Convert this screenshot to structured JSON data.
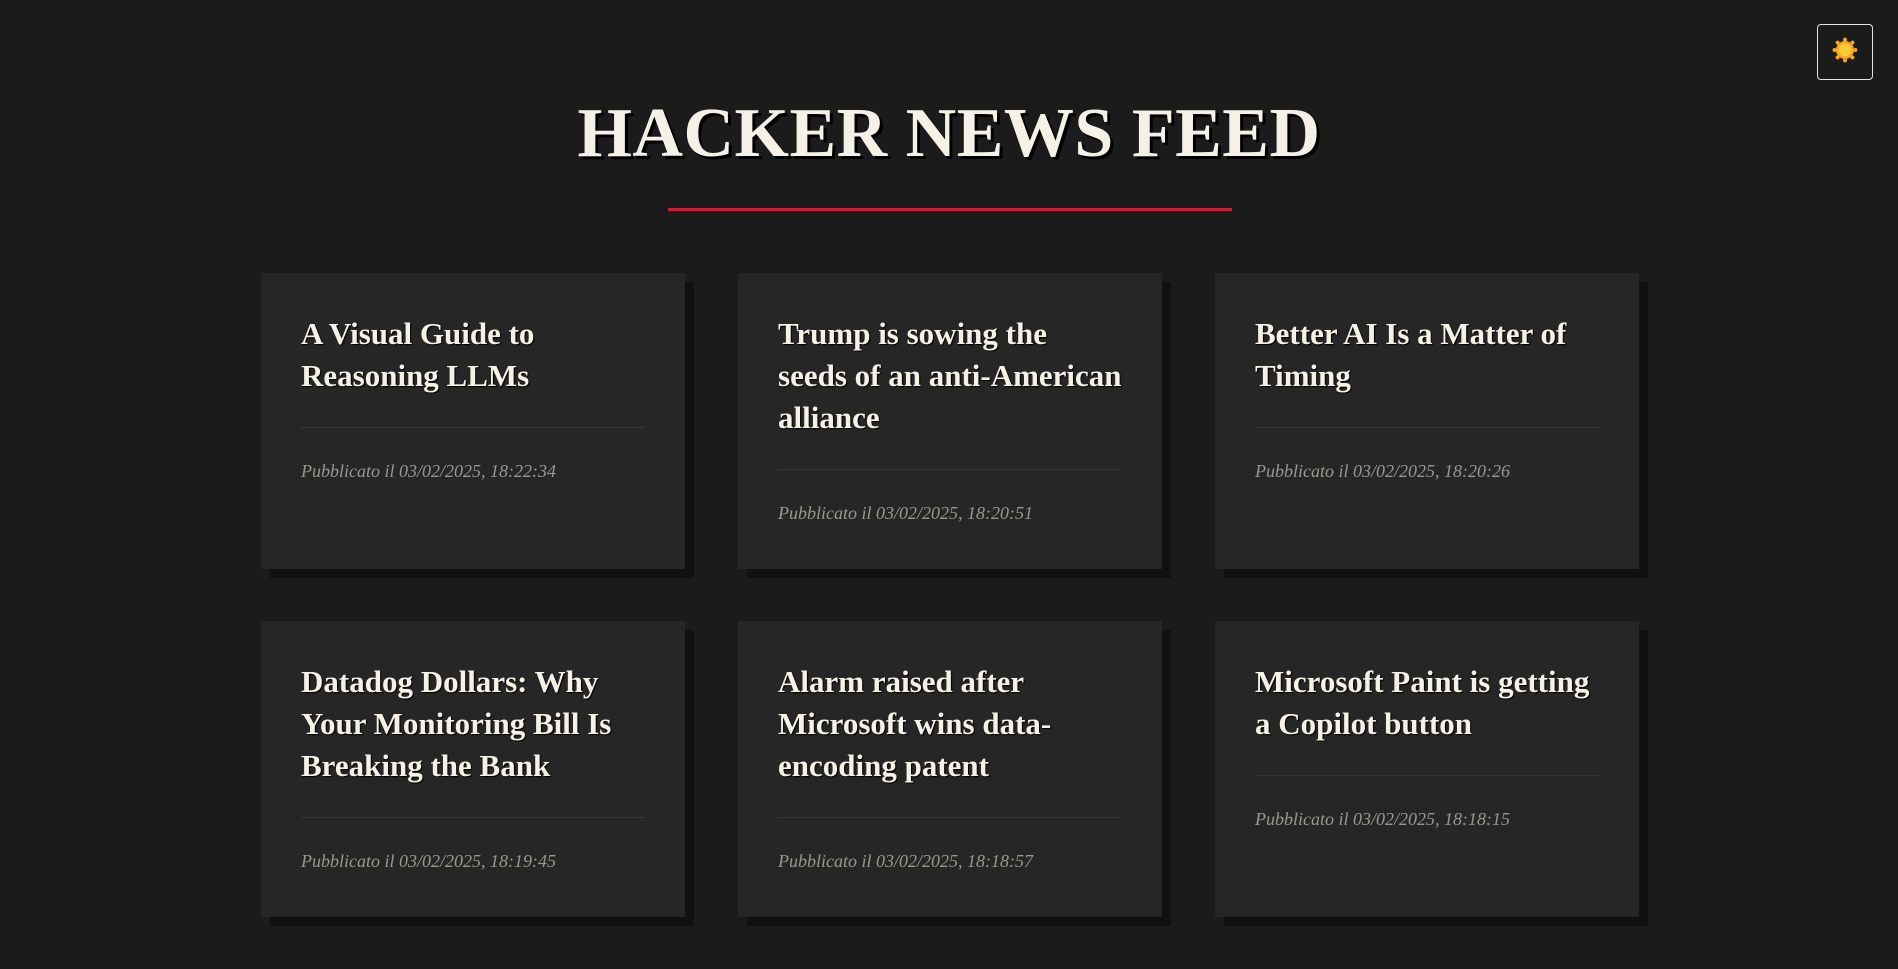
{
  "header": {
    "title": "HACKER NEWS FEED"
  },
  "theme_toggle": {
    "icon": "sun-icon",
    "icon_color": "#f5a623"
  },
  "colors": {
    "background": "#1b1b1b",
    "card": "#262626",
    "accent": "#c8203a",
    "text": "#f5f1e6",
    "meta": "#9a978f"
  },
  "articles": [
    {
      "title": "A Visual Guide to Reasoning LLMs",
      "published": "Pubblicato il 03/02/2025, 18:22:34"
    },
    {
      "title": "Trump is sowing the seeds of an anti-American alliance",
      "published": "Pubblicato il 03/02/2025, 18:20:51"
    },
    {
      "title": "Better AI Is a Matter of Timing",
      "published": "Pubblicato il 03/02/2025, 18:20:26"
    },
    {
      "title": "Datadog Dollars: Why Your Monitoring Bill Is Breaking the Bank",
      "published": "Pubblicato il 03/02/2025, 18:19:45"
    },
    {
      "title": "Alarm raised after Microsoft wins data-encoding patent",
      "published": "Pubblicato il 03/02/2025, 18:18:57"
    },
    {
      "title": "Microsoft Paint is getting a Copilot button",
      "published": "Pubblicato il 03/02/2025, 18:18:15"
    }
  ]
}
